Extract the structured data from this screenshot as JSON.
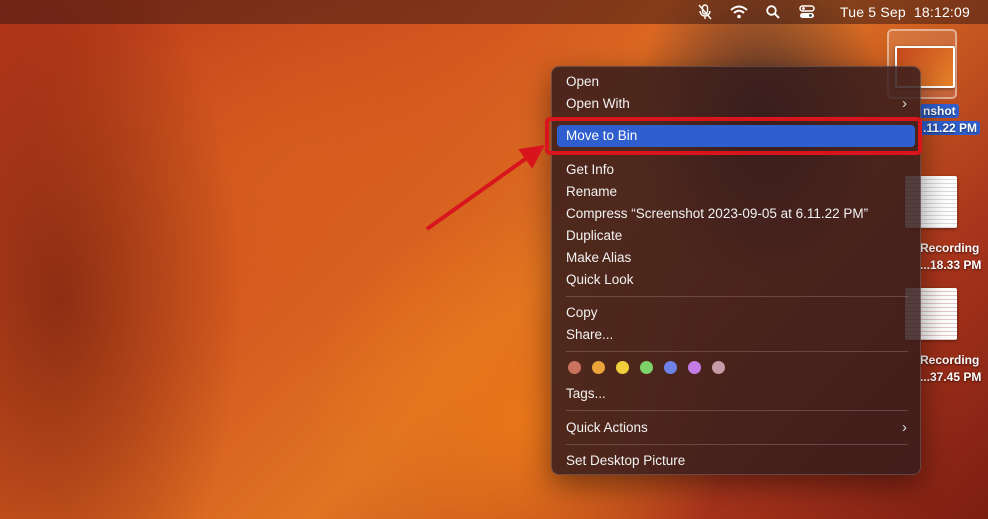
{
  "menubar": {
    "date": "Tue 5 Sep",
    "time": "18:12:09",
    "icons": [
      "mic-off-icon",
      "wifi-icon",
      "search-icon",
      "control-center-icon"
    ]
  },
  "desktop": {
    "files": [
      {
        "name_line1": "nshot",
        "name_line2": ".11.22 PM",
        "selected": true
      },
      {
        "name_line1": "Recording",
        "name_line2": "...18.33 PM"
      },
      {
        "name_line1": "Recording",
        "name_line2": "...37.45 PM"
      }
    ]
  },
  "context_menu": {
    "open": "Open",
    "open_with": "Open With",
    "move_to_bin": "Move to Bin",
    "get_info": "Get Info",
    "rename": "Rename",
    "compress": "Compress “Screenshot 2023-09-05 at 6.11.22 PM”",
    "duplicate": "Duplicate",
    "make_alias": "Make Alias",
    "quick_look": "Quick Look",
    "copy": "Copy",
    "share": "Share...",
    "tags": "Tags...",
    "quick_actions": "Quick Actions",
    "set_desktop_picture": "Set Desktop Picture",
    "chevron": "›",
    "tag_colors": [
      "#c9735f",
      "#eaa43a",
      "#f1cf3a",
      "#7dd36a",
      "#6f82e8",
      "#c47be3",
      "#c79aa7"
    ]
  },
  "annotation": {
    "highlight_color": "#d8141d"
  }
}
